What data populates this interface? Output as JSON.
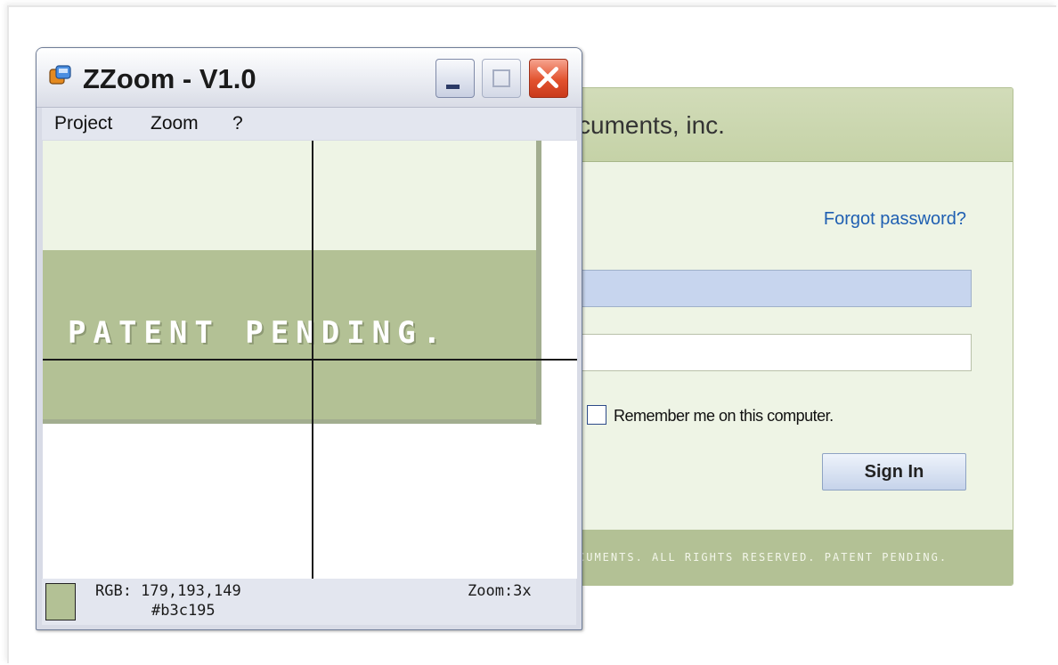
{
  "login": {
    "title_fragment": "cuments, inc.",
    "forgot_password": "Forgot password?",
    "remember_me": "Remember me on this computer.",
    "sign_in": "Sign In",
    "footer": "CUMENTS. ALL RIGHTS RESERVED. PATENT PENDING.",
    "colors": {
      "panel": "#eef4e5",
      "header": "#c5d2a7",
      "footer": "#b3c195",
      "link": "#1f5fb2"
    }
  },
  "zzoom": {
    "title": "ZZoom - V1.0",
    "menu": [
      "Project",
      "Zoom",
      "?"
    ],
    "canvas_text": "PATENT PENDING.",
    "status": {
      "rgb": "RGB: 179,193,149",
      "hex": "#b3c195",
      "zoom": "Zoom:3x",
      "swatch_color": "#b3c195"
    },
    "icons": [
      "app-icon",
      "minimize-icon",
      "maximize-icon",
      "close-icon"
    ]
  }
}
